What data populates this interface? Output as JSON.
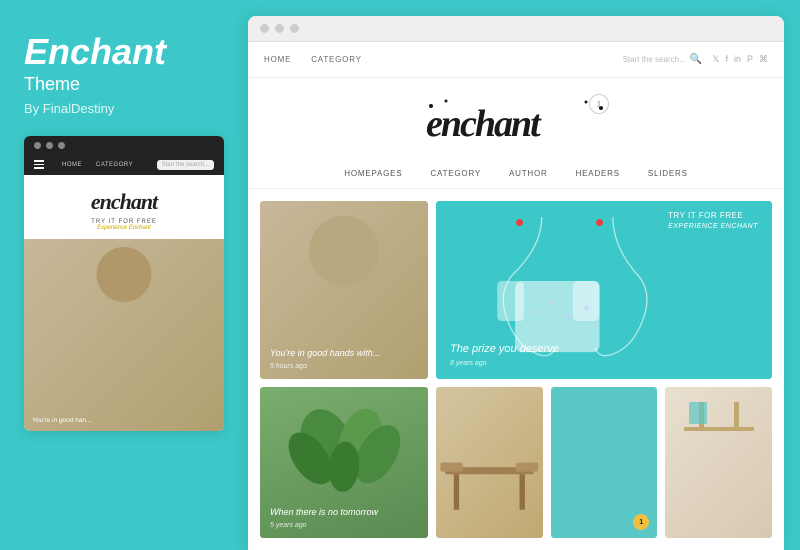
{
  "sidebar": {
    "title": "Enchant",
    "subtitle": "Theme",
    "author": "By FinalDestiny",
    "mini_nav": {
      "items": [
        "HOME",
        "CATEGORY"
      ],
      "search_placeholder": "Start the search..."
    },
    "mini_logo": "enchant",
    "mini_cta": "TRY IT FOR FREE",
    "mini_cta_sub": "Experience Enchant",
    "mini_caption": "You're in good han..."
  },
  "browser": {
    "dots": [
      "dot1",
      "dot2",
      "dot3"
    ]
  },
  "theme": {
    "nav": {
      "items": [
        "HOME",
        "CATEGORY"
      ],
      "search_placeholder": "Start the search...",
      "social_icons": [
        "twitter",
        "facebook",
        "linkedin",
        "pinterest"
      ]
    },
    "logo": "enchant",
    "logo_badge": "↑",
    "sec_nav": {
      "items": [
        "HOMEPAGES",
        "CATEGORY",
        "AUTHOR",
        "HEADERS",
        "SLIDERS"
      ]
    },
    "cards": [
      {
        "id": "card-1",
        "type": "food",
        "caption": "You're in good hands with...",
        "date": "5 hours ago"
      },
      {
        "id": "card-2",
        "type": "teal-clothing",
        "caption": "The prize you deserve",
        "date": "8 years ago",
        "badge_top": "TRY IT FOR FREE",
        "badge_sub": "Experience Enchant"
      },
      {
        "id": "card-3",
        "type": "plant",
        "caption": "When there is no tomorrow",
        "date": "5 years ago"
      }
    ],
    "bottom_cards": [
      {
        "id": "bc-1",
        "type": "wood"
      },
      {
        "id": "bc-2",
        "type": "teal",
        "badge": "1"
      },
      {
        "id": "bc-3",
        "type": "light"
      }
    ]
  }
}
